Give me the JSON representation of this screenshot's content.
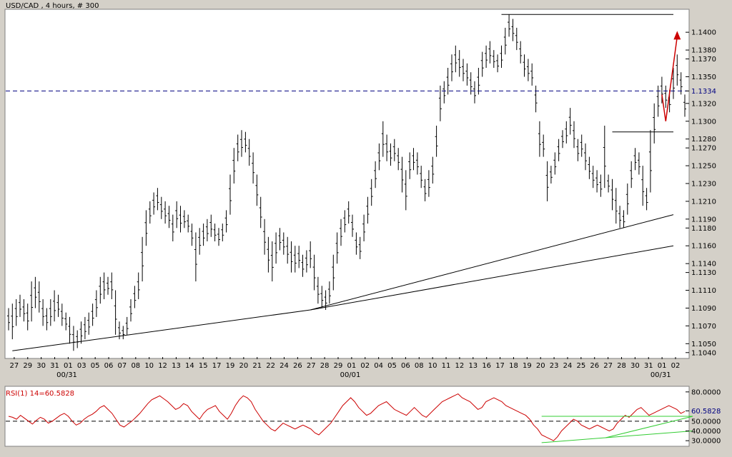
{
  "price_panel": {
    "title": "USD/CAD , 4 hours, # 300",
    "current_price_label": "1.1334",
    "y_ticks": [
      "1.1400",
      "1.1380",
      "1.1370",
      "1.1350",
      "1.1334",
      "1.1320",
      "1.1300",
      "1.1280",
      "1.1270",
      "1.1250",
      "1.1230",
      "1.1210",
      "1.1190",
      "1.1180",
      "1.1160",
      "1.1140",
      "1.1130",
      "1.1110",
      "1.1090",
      "1.1070",
      "1.1050",
      "1.1040"
    ],
    "x_ticks": [
      "27",
      "29",
      "30",
      "31",
      "01",
      "03",
      "05",
      "06",
      "07",
      "08",
      "10",
      "12",
      "13",
      "14",
      "15",
      "17",
      "19",
      "20",
      "21",
      "22",
      "24",
      "26",
      "27",
      "28",
      "29",
      "01",
      "02",
      "04",
      "05",
      "06",
      "08",
      "10",
      "11",
      "12",
      "13",
      "16",
      "17",
      "18",
      "19",
      "20",
      "23",
      "24",
      "25",
      "26",
      "27",
      "28",
      "30",
      "31",
      "01",
      "02"
    ],
    "month_labels": [
      "00/31",
      "00/01",
      "00/31"
    ]
  },
  "rsi_panel": {
    "title": "RSI(1) 14=60.5828",
    "current_value_label": "60.5828",
    "y_ticks": [
      "80.0000",
      "60.5828",
      "50.0000",
      "40.0000",
      "30.0000"
    ]
  },
  "colors": {
    "background": "#ffffff",
    "frame": "#d4d0c8",
    "bars": "#000000",
    "rsi_line": "#cc0000",
    "rsi_trend": "#33cc33",
    "current_price_line": "#000080",
    "arrow": "#cc0000"
  },
  "chart_data": [
    {
      "type": "ohlc",
      "title": "USD/CAD , 4 hours, # 300",
      "ylim": [
        1.1035,
        1.1425
      ],
      "reference_line": 1.1334,
      "series": [
        {
          "low": 1.1065,
          "high": 1.109
        },
        {
          "low": 1.1055,
          "high": 1.1095
        },
        {
          "low": 1.107,
          "high": 1.11
        },
        {
          "low": 1.108,
          "high": 1.1105
        },
        {
          "low": 1.1075,
          "high": 1.11
        },
        {
          "low": 1.1065,
          "high": 1.1095
        },
        {
          "low": 1.1075,
          "high": 1.112
        },
        {
          "low": 1.109,
          "high": 1.1125
        },
        {
          "low": 1.1085,
          "high": 1.112
        },
        {
          "low": 1.107,
          "high": 1.11
        },
        {
          "low": 1.1065,
          "high": 1.109
        },
        {
          "low": 1.107,
          "high": 1.11
        },
        {
          "low": 1.1075,
          "high": 1.111
        },
        {
          "low": 1.108,
          "high": 1.1105
        },
        {
          "low": 1.107,
          "high": 1.1095
        },
        {
          "low": 1.1065,
          "high": 1.1085
        },
        {
          "low": 1.105,
          "high": 1.108
        },
        {
          "low": 1.1042,
          "high": 1.107
        },
        {
          "low": 1.1045,
          "high": 1.1065
        },
        {
          "low": 1.105,
          "high": 1.1075
        },
        {
          "low": 1.1055,
          "high": 1.108
        },
        {
          "low": 1.106,
          "high": 1.1085
        },
        {
          "low": 1.107,
          "high": 1.1095
        },
        {
          "low": 1.108,
          "high": 1.111
        },
        {
          "low": 1.1095,
          "high": 1.1125
        },
        {
          "low": 1.11,
          "high": 1.113
        },
        {
          "low": 1.1105,
          "high": 1.1125
        },
        {
          "low": 1.11,
          "high": 1.113
        },
        {
          "low": 1.106,
          "high": 1.111
        },
        {
          "low": 1.1055,
          "high": 1.1075
        },
        {
          "low": 1.1055,
          "high": 1.107
        },
        {
          "low": 1.106,
          "high": 1.108
        },
        {
          "low": 1.1075,
          "high": 1.11
        },
        {
          "low": 1.109,
          "high": 1.1115
        },
        {
          "low": 1.11,
          "high": 1.113
        },
        {
          "low": 1.112,
          "high": 1.117
        },
        {
          "low": 1.116,
          "high": 1.12
        },
        {
          "low": 1.1185,
          "high": 1.121
        },
        {
          "low": 1.1195,
          "high": 1.122
        },
        {
          "low": 1.12,
          "high": 1.1225
        },
        {
          "low": 1.119,
          "high": 1.1215
        },
        {
          "low": 1.1185,
          "high": 1.121
        },
        {
          "low": 1.118,
          "high": 1.1205
        },
        {
          "low": 1.1165,
          "high": 1.1195
        },
        {
          "low": 1.118,
          "high": 1.121
        },
        {
          "low": 1.1175,
          "high": 1.1205
        },
        {
          "low": 1.118,
          "high": 1.12
        },
        {
          "low": 1.1175,
          "high": 1.1195
        },
        {
          "low": 1.116,
          "high": 1.1185
        },
        {
          "low": 1.112,
          "high": 1.1175
        },
        {
          "low": 1.115,
          "high": 1.118
        },
        {
          "low": 1.116,
          "high": 1.1185
        },
        {
          "low": 1.1165,
          "high": 1.119
        },
        {
          "low": 1.117,
          "high": 1.1195
        },
        {
          "low": 1.1165,
          "high": 1.1185
        },
        {
          "low": 1.116,
          "high": 1.118
        },
        {
          "low": 1.1165,
          "high": 1.1185
        },
        {
          "low": 1.1175,
          "high": 1.12
        },
        {
          "low": 1.1195,
          "high": 1.124
        },
        {
          "low": 1.123,
          "high": 1.127
        },
        {
          "low": 1.1255,
          "high": 1.1285
        },
        {
          "low": 1.126,
          "high": 1.129
        },
        {
          "low": 1.1265,
          "high": 1.1288
        },
        {
          "low": 1.125,
          "high": 1.128
        },
        {
          "low": 1.123,
          "high": 1.1265
        },
        {
          "low": 1.1205,
          "high": 1.124
        },
        {
          "low": 1.118,
          "high": 1.1215
        },
        {
          "low": 1.115,
          "high": 1.119
        },
        {
          "low": 1.113,
          "high": 1.117
        },
        {
          "low": 1.112,
          "high": 1.1165
        },
        {
          "low": 1.114,
          "high": 1.1175
        },
        {
          "low": 1.1155,
          "high": 1.118
        },
        {
          "low": 1.115,
          "high": 1.1175
        },
        {
          "low": 1.114,
          "high": 1.117
        },
        {
          "low": 1.113,
          "high": 1.1165
        },
        {
          "low": 1.113,
          "high": 1.116
        },
        {
          "low": 1.1135,
          "high": 1.116
        },
        {
          "low": 1.1125,
          "high": 1.115
        },
        {
          "low": 1.113,
          "high": 1.1155
        },
        {
          "low": 1.1135,
          "high": 1.1165
        },
        {
          "low": 1.111,
          "high": 1.115
        },
        {
          "low": 1.1095,
          "high": 1.1125
        },
        {
          "low": 1.109,
          "high": 1.1115
        },
        {
          "low": 1.1088,
          "high": 1.111
        },
        {
          "low": 1.1095,
          "high": 1.112
        },
        {
          "low": 1.111,
          "high": 1.115
        },
        {
          "low": 1.114,
          "high": 1.1175
        },
        {
          "low": 1.116,
          "high": 1.119
        },
        {
          "low": 1.1175,
          "high": 1.12
        },
        {
          "low": 1.1185,
          "high": 1.121
        },
        {
          "low": 1.117,
          "high": 1.1195
        },
        {
          "low": 1.115,
          "high": 1.1175
        },
        {
          "low": 1.1145,
          "high": 1.117
        },
        {
          "low": 1.1165,
          "high": 1.1195
        },
        {
          "low": 1.1185,
          "high": 1.1215
        },
        {
          "low": 1.1205,
          "high": 1.1235
        },
        {
          "low": 1.1225,
          "high": 1.1255
        },
        {
          "low": 1.1245,
          "high": 1.1275
        },
        {
          "low": 1.126,
          "high": 1.13
        },
        {
          "low": 1.1255,
          "high": 1.1285
        },
        {
          "low": 1.125,
          "high": 1.1275
        },
        {
          "low": 1.1255,
          "high": 1.128
        },
        {
          "low": 1.1245,
          "high": 1.127
        },
        {
          "low": 1.122,
          "high": 1.126
        },
        {
          "low": 1.12,
          "high": 1.1245
        },
        {
          "low": 1.1235,
          "high": 1.1265
        },
        {
          "low": 1.1245,
          "high": 1.127
        },
        {
          "low": 1.124,
          "high": 1.1265
        },
        {
          "low": 1.1225,
          "high": 1.125
        },
        {
          "low": 1.121,
          "high": 1.1235
        },
        {
          "low": 1.1215,
          "high": 1.1245
        },
        {
          "low": 1.123,
          "high": 1.126
        },
        {
          "low": 1.126,
          "high": 1.1295
        },
        {
          "low": 1.13,
          "high": 1.134
        },
        {
          "low": 1.132,
          "high": 1.1345
        },
        {
          "low": 1.133,
          "high": 1.136
        },
        {
          "low": 1.1345,
          "high": 1.1375
        },
        {
          "low": 1.1355,
          "high": 1.1385
        },
        {
          "low": 1.135,
          "high": 1.138
        },
        {
          "low": 1.1345,
          "high": 1.137
        },
        {
          "low": 1.134,
          "high": 1.1365
        },
        {
          "low": 1.133,
          "high": 1.1355
        },
        {
          "low": 1.132,
          "high": 1.1345
        },
        {
          "low": 1.133,
          "high": 1.136
        },
        {
          "low": 1.135,
          "high": 1.1378
        },
        {
          "low": 1.136,
          "high": 1.1385
        },
        {
          "low": 1.1365,
          "high": 1.139
        },
        {
          "low": 1.136,
          "high": 1.138
        },
        {
          "low": 1.1355,
          "high": 1.1375
        },
        {
          "low": 1.136,
          "high": 1.1385
        },
        {
          "low": 1.1375,
          "high": 1.1405
        },
        {
          "low": 1.1395,
          "high": 1.142
        },
        {
          "low": 1.139,
          "high": 1.1415
        },
        {
          "low": 1.138,
          "high": 1.1405
        },
        {
          "low": 1.1365,
          "high": 1.139
        },
        {
          "low": 1.135,
          "high": 1.1375
        },
        {
          "low": 1.1345,
          "high": 1.137
        },
        {
          "low": 1.134,
          "high": 1.1365
        },
        {
          "low": 1.131,
          "high": 1.134
        },
        {
          "low": 1.126,
          "high": 1.13
        },
        {
          "low": 1.126,
          "high": 1.1285
        },
        {
          "low": 1.121,
          "high": 1.1255
        },
        {
          "low": 1.123,
          "high": 1.125
        },
        {
          "low": 1.124,
          "high": 1.1265
        },
        {
          "low": 1.1255,
          "high": 1.128
        },
        {
          "low": 1.127,
          "high": 1.129
        },
        {
          "low": 1.1275,
          "high": 1.13
        },
        {
          "low": 1.1285,
          "high": 1.1315
        },
        {
          "low": 1.127,
          "high": 1.13
        },
        {
          "low": 1.1255,
          "high": 1.128
        },
        {
          "low": 1.126,
          "high": 1.1285
        },
        {
          "low": 1.1245,
          "high": 1.1275
        },
        {
          "low": 1.1235,
          "high": 1.126
        },
        {
          "low": 1.1225,
          "high": 1.125
        },
        {
          "low": 1.122,
          "high": 1.1245
        },
        {
          "low": 1.1215,
          "high": 1.124
        },
        {
          "low": 1.1225,
          "high": 1.1295
        },
        {
          "low": 1.122,
          "high": 1.124
        },
        {
          "low": 1.12,
          "high": 1.1235
        },
        {
          "low": 1.1185,
          "high": 1.1225
        },
        {
          "low": 1.118,
          "high": 1.1205
        },
        {
          "low": 1.118,
          "high": 1.12
        },
        {
          "low": 1.1195,
          "high": 1.123
        },
        {
          "low": 1.1225,
          "high": 1.1255
        },
        {
          "low": 1.1245,
          "high": 1.127
        },
        {
          "low": 1.124,
          "high": 1.1265
        },
        {
          "low": 1.1205,
          "high": 1.125
        },
        {
          "low": 1.12,
          "high": 1.1225
        },
        {
          "low": 1.122,
          "high": 1.129
        },
        {
          "low": 1.1275,
          "high": 1.132
        },
        {
          "low": 1.1305,
          "high": 1.134
        },
        {
          "low": 1.132,
          "high": 1.135
        },
        {
          "low": 1.1315,
          "high": 1.134
        },
        {
          "low": 1.131,
          "high": 1.1335
        },
        {
          "low": 1.1325,
          "high": 1.136
        },
        {
          "low": 1.134,
          "high": 1.1375
        },
        {
          "low": 1.133,
          "high": 1.1355
        },
        {
          "low": 1.1305,
          "high": 1.133
        }
      ],
      "trendlines": [
        {
          "from": [
            1,
            1.1042
          ],
          "to": [
            79,
            1.1088
          ],
          "color": "#000000"
        },
        {
          "from": [
            79,
            1.1088
          ],
          "to": [
            174,
            1.1195
          ],
          "color": "#000000"
        },
        {
          "from": [
            79,
            1.1088
          ],
          "to": [
            174,
            1.116
          ],
          "color": "#000000"
        },
        {
          "from": [
            129,
            1.142
          ],
          "to": [
            174,
            1.142
          ],
          "color": "#000000"
        },
        {
          "from": [
            158,
            1.1288
          ],
          "to": [
            174,
            1.1288
          ],
          "color": "#000000"
        }
      ],
      "arrow": {
        "points": [
          [
            171,
            1.133
          ],
          [
            172,
            1.13
          ],
          [
            175,
            1.1395
          ]
        ],
        "color": "#cc0000"
      }
    },
    {
      "type": "line",
      "title": "RSI(1) 14=60.5828",
      "ylim": [
        25,
        85
      ],
      "reference_line": 50,
      "series": [
        {
          "name": "RSI",
          "values": [
            55,
            54,
            52,
            56,
            53,
            50,
            47,
            51,
            54,
            52,
            48,
            50,
            53,
            56,
            58,
            55,
            50,
            46,
            48,
            52,
            55,
            57,
            60,
            64,
            66,
            62,
            58,
            52,
            46,
            44,
            47,
            50,
            54,
            58,
            63,
            68,
            72,
            74,
            76,
            73,
            70,
            66,
            62,
            64,
            68,
            66,
            60,
            56,
            52,
            58,
            62,
            64,
            66,
            60,
            56,
            52,
            58,
            66,
            72,
            76,
            74,
            70,
            62,
            56,
            50,
            46,
            42,
            40,
            44,
            48,
            46,
            44,
            42,
            44,
            46,
            44,
            42,
            38,
            36,
            40,
            44,
            48,
            54,
            60,
            66,
            70,
            74,
            70,
            64,
            60,
            56,
            58,
            62,
            66,
            68,
            70,
            66,
            62,
            60,
            58,
            56,
            60,
            64,
            60,
            56,
            54,
            58,
            62,
            66,
            70,
            72,
            74,
            76,
            78,
            74,
            72,
            70,
            66,
            62,
            64,
            70,
            72,
            74,
            72,
            70,
            66,
            64,
            62,
            60,
            58,
            56,
            52,
            46,
            42,
            36,
            34,
            32,
            30,
            34,
            40,
            44,
            48,
            52,
            50,
            46,
            44,
            42,
            44,
            46,
            44,
            42,
            40,
            42,
            48,
            52,
            56,
            54,
            58,
            62,
            64,
            60,
            56,
            58,
            60,
            62,
            64,
            66,
            64,
            62,
            58,
            60
          ]
        }
      ],
      "trendlines": [
        {
          "from": [
            134,
            55
          ],
          "to": [
            172,
            55
          ],
          "color": "#33cc33"
        },
        {
          "from": [
            134,
            28
          ],
          "to": [
            172,
            40
          ],
          "color": "#33cc33"
        },
        {
          "from": [
            150,
            33
          ],
          "to": [
            172,
            55
          ],
          "color": "#33cc33"
        }
      ]
    }
  ]
}
